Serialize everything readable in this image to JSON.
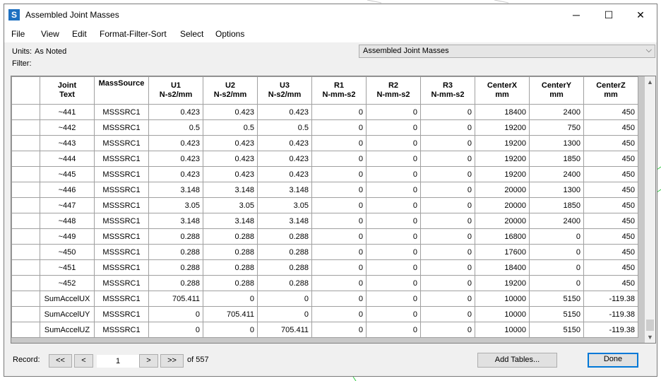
{
  "window": {
    "icon_letter": "S",
    "title": "Assembled Joint Masses",
    "minimize": "─",
    "maximize": "☐",
    "close": "✕"
  },
  "menu": [
    "File",
    "View",
    "Edit",
    "Format-Filter-Sort",
    "Select",
    "Options"
  ],
  "units_label": "Units:",
  "units_value": "As Noted",
  "filter_label": "Filter:",
  "table_select": {
    "value": "Assembled Joint Masses"
  },
  "columns": [
    {
      "line1": "Joint",
      "line2": "Text"
    },
    {
      "line1": "MassSource",
      "line2": ""
    },
    {
      "line1": "U1",
      "line2": "N-s2/mm"
    },
    {
      "line1": "U2",
      "line2": "N-s2/mm"
    },
    {
      "line1": "U3",
      "line2": "N-s2/mm"
    },
    {
      "line1": "R1",
      "line2": "N-mm-s2"
    },
    {
      "line1": "R2",
      "line2": "N-mm-s2"
    },
    {
      "line1": "R3",
      "line2": "N-mm-s2"
    },
    {
      "line1": "CenterX",
      "line2": "mm"
    },
    {
      "line1": "CenterY",
      "line2": "mm"
    },
    {
      "line1": "CenterZ",
      "line2": "mm"
    }
  ],
  "rows": [
    [
      "~441",
      "MSSSRC1",
      "0.423",
      "0.423",
      "0.423",
      "0",
      "0",
      "0",
      "18400",
      "2400",
      "450"
    ],
    [
      "~442",
      "MSSSRC1",
      "0.5",
      "0.5",
      "0.5",
      "0",
      "0",
      "0",
      "19200",
      "750",
      "450"
    ],
    [
      "~443",
      "MSSSRC1",
      "0.423",
      "0.423",
      "0.423",
      "0",
      "0",
      "0",
      "19200",
      "1300",
      "450"
    ],
    [
      "~444",
      "MSSSRC1",
      "0.423",
      "0.423",
      "0.423",
      "0",
      "0",
      "0",
      "19200",
      "1850",
      "450"
    ],
    [
      "~445",
      "MSSSRC1",
      "0.423",
      "0.423",
      "0.423",
      "0",
      "0",
      "0",
      "19200",
      "2400",
      "450"
    ],
    [
      "~446",
      "MSSSRC1",
      "3.148",
      "3.148",
      "3.148",
      "0",
      "0",
      "0",
      "20000",
      "1300",
      "450"
    ],
    [
      "~447",
      "MSSSRC1",
      "3.05",
      "3.05",
      "3.05",
      "0",
      "0",
      "0",
      "20000",
      "1850",
      "450"
    ],
    [
      "~448",
      "MSSSRC1",
      "3.148",
      "3.148",
      "3.148",
      "0",
      "0",
      "0",
      "20000",
      "2400",
      "450"
    ],
    [
      "~449",
      "MSSSRC1",
      "0.288",
      "0.288",
      "0.288",
      "0",
      "0",
      "0",
      "16800",
      "0",
      "450"
    ],
    [
      "~450",
      "MSSSRC1",
      "0.288",
      "0.288",
      "0.288",
      "0",
      "0",
      "0",
      "17600",
      "0",
      "450"
    ],
    [
      "~451",
      "MSSSRC1",
      "0.288",
      "0.288",
      "0.288",
      "0",
      "0",
      "0",
      "18400",
      "0",
      "450"
    ],
    [
      "~452",
      "MSSSRC1",
      "0.288",
      "0.288",
      "0.288",
      "0",
      "0",
      "0",
      "19200",
      "0",
      "450"
    ],
    [
      "SumAccelUX",
      "MSSSRC1",
      "705.411",
      "0",
      "0",
      "0",
      "0",
      "0",
      "10000",
      "5150",
      "-119.38"
    ],
    [
      "SumAccelUY",
      "MSSSRC1",
      "0",
      "705.411",
      "0",
      "0",
      "0",
      "0",
      "10000",
      "5150",
      "-119.38"
    ],
    [
      "SumAccelUZ",
      "MSSSRC1",
      "0",
      "0",
      "705.411",
      "0",
      "0",
      "0",
      "10000",
      "5150",
      "-119.38"
    ]
  ],
  "record": {
    "label": "Record:",
    "first": "<<",
    "prev": "<",
    "current": "1",
    "next": ">",
    "last": ">>",
    "of_text": "of 557"
  },
  "add_tables_label": "Add Tables...",
  "done_label": "Done",
  "colors": {
    "done_border": "#0078d7",
    "app_icon": "#1e70c1"
  },
  "icons": {
    "app": "app-s-icon",
    "scroll_up": "chevron-up-icon",
    "scroll_down": "chevron-down-icon",
    "combo": "chevron-down-icon"
  }
}
